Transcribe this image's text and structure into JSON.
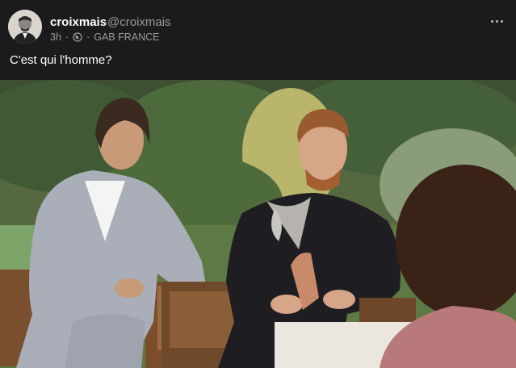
{
  "post": {
    "display_name": "croixmais",
    "handle": "@croixmais",
    "time": "3h",
    "separator": "·",
    "group": "GAB FRANCE",
    "text": "C'est qui l'homme?"
  },
  "icons": {
    "avatar": "portrait-avatar",
    "visibility": "globe-icon",
    "more": "ellipsis-icon"
  },
  "colors": {
    "background": "#1b1b1d",
    "name": "#ffffff",
    "muted": "#9b9b9b"
  }
}
